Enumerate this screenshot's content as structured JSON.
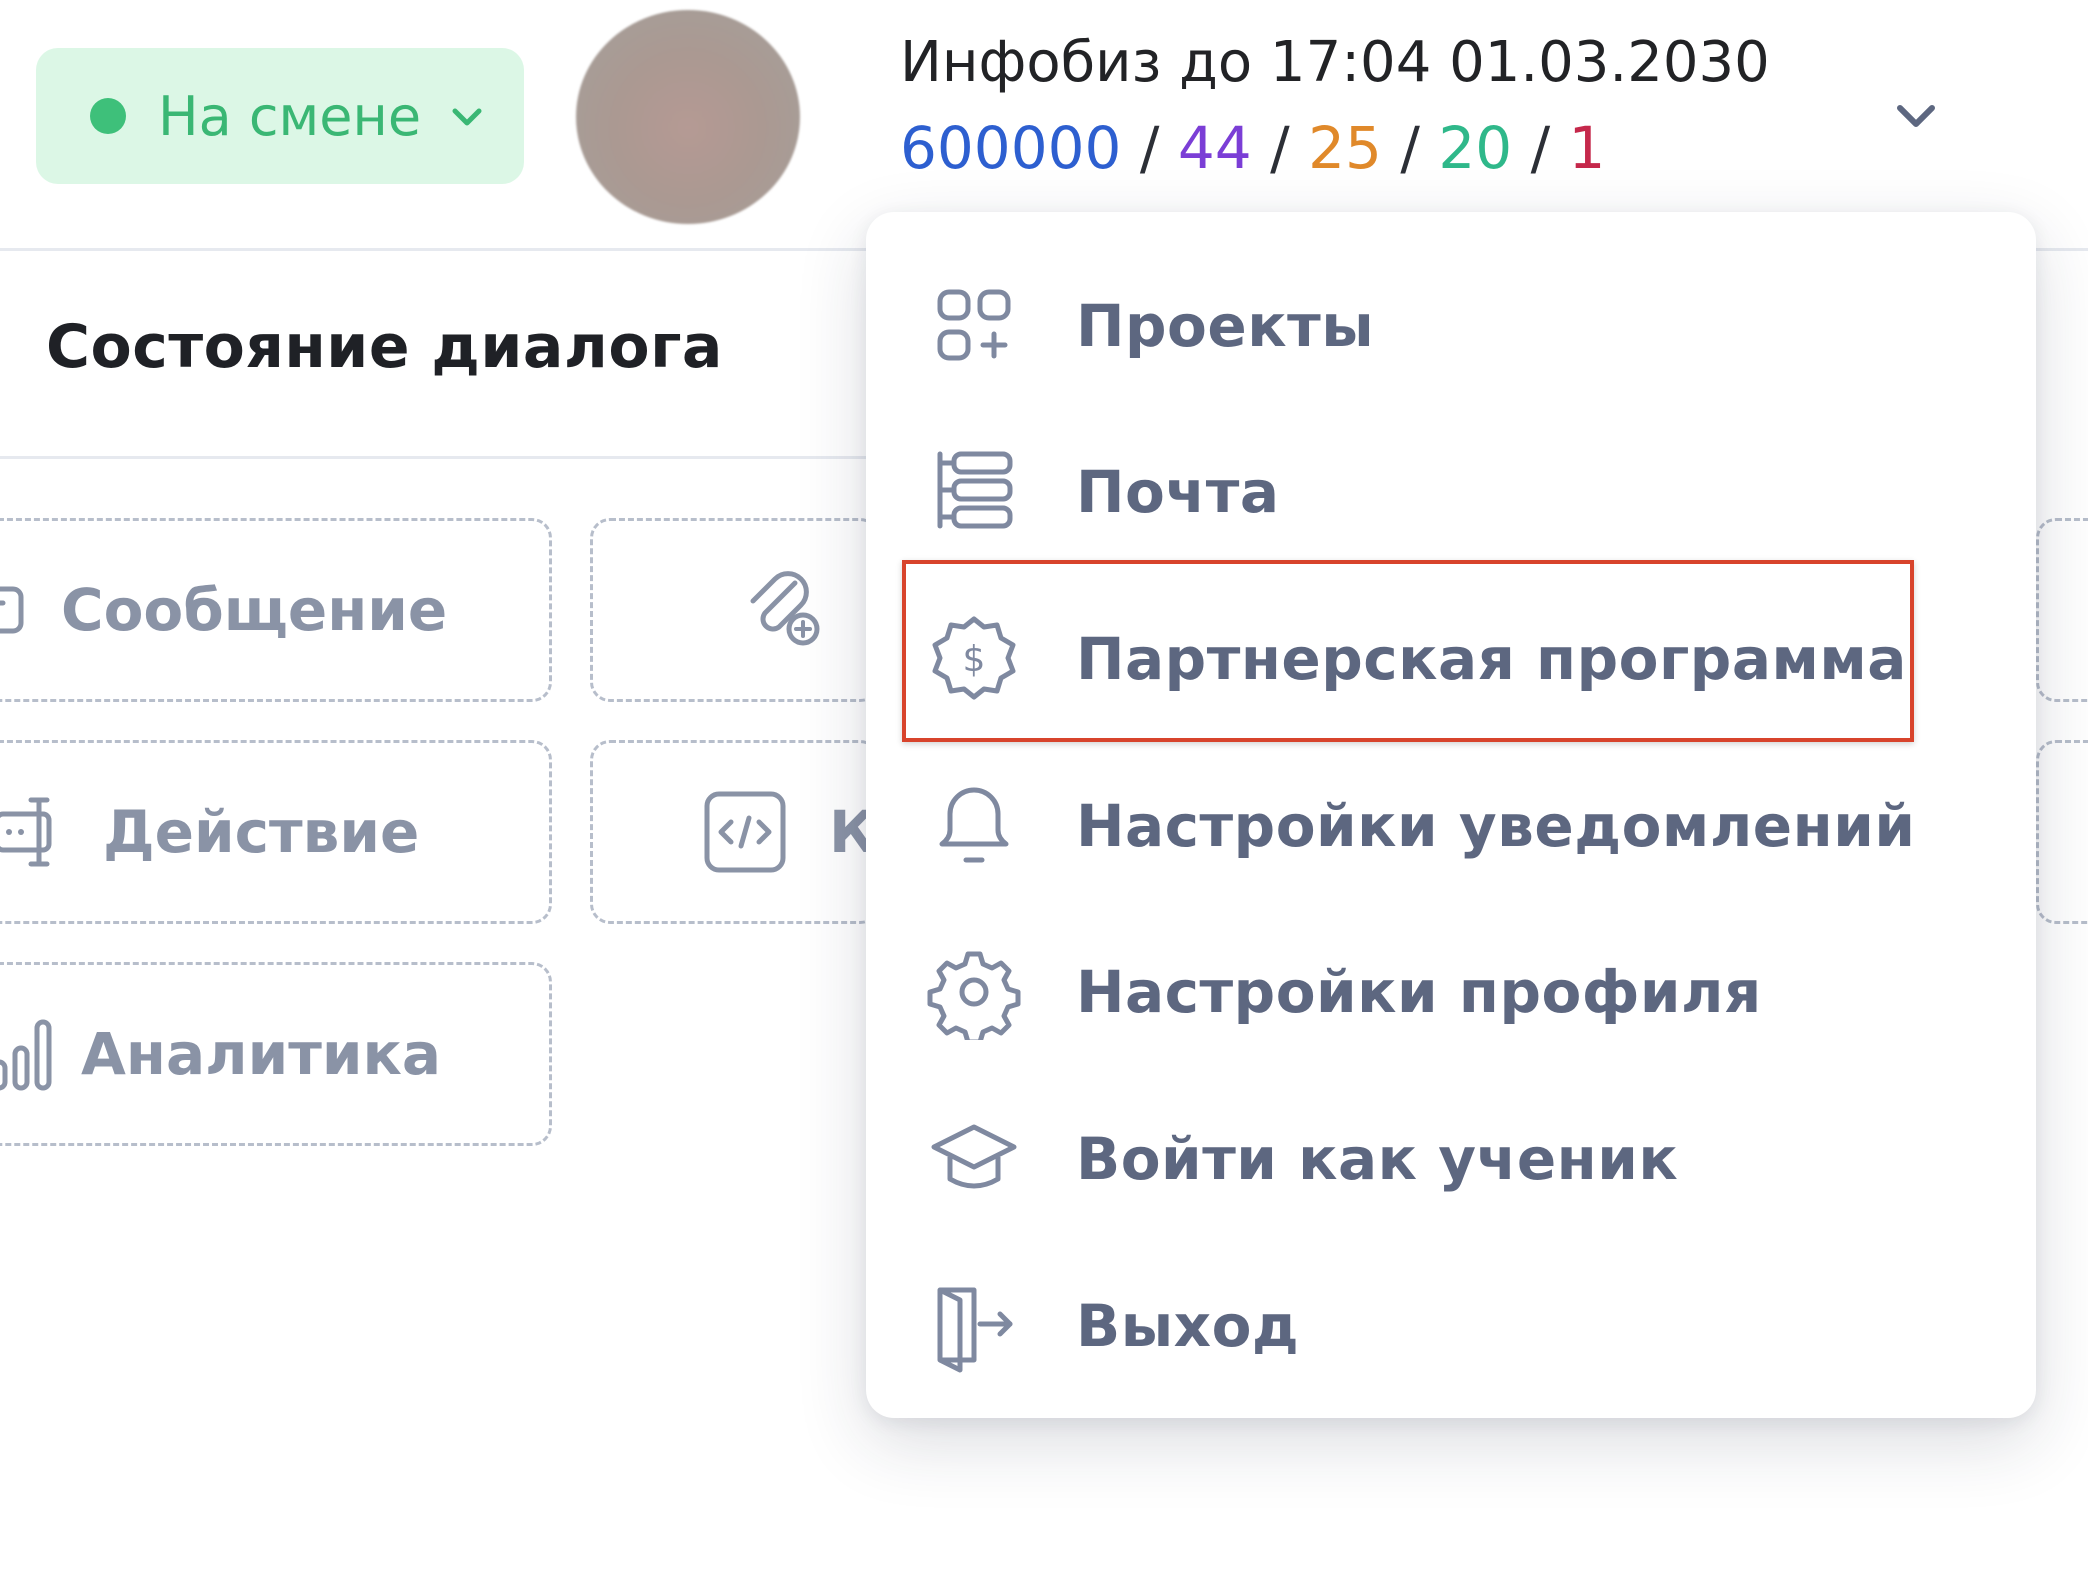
{
  "header": {
    "status": {
      "label": "На смене",
      "dot_color": "#3ec07a",
      "icon": "chevron-down-icon"
    },
    "account": {
      "title": "Инфобиз до 17:04 01.03.2030",
      "stats": [
        {
          "value": "600000",
          "color": "#2d5fd0"
        },
        {
          "value": "44",
          "color": "#7b3ed6"
        },
        {
          "value": "25",
          "color": "#e0892a"
        },
        {
          "value": "20",
          "color": "#2fb88a"
        },
        {
          "value": "1",
          "color": "#c5284b"
        }
      ],
      "separator": "/"
    }
  },
  "section": {
    "title": "Состояние диалога"
  },
  "tiles": [
    {
      "label": "Сообщение",
      "icon": "message-icon"
    },
    {
      "label": "",
      "icon": "attachment-add-icon"
    },
    {
      "label": "Действие",
      "icon": "action-icon"
    },
    {
      "label": "К",
      "icon": "code-icon"
    },
    {
      "label": "Аналитика",
      "icon": "analytics-icon"
    }
  ],
  "menu": {
    "items": [
      {
        "label": "Проекты",
        "icon": "projects-icon"
      },
      {
        "label": "Почта",
        "icon": "mail-icon"
      },
      {
        "label": "Партнерская программа",
        "icon": "dollar-badge-icon",
        "highlighted": true
      },
      {
        "label": "Настройки уведомлений",
        "icon": "bell-icon"
      },
      {
        "label": "Настройки профиля",
        "icon": "gear-icon"
      },
      {
        "label": "Войти как ученик",
        "icon": "graduation-cap-icon"
      },
      {
        "label": "Выход",
        "icon": "logout-icon"
      }
    ],
    "highlight_color": "#d8442c"
  }
}
